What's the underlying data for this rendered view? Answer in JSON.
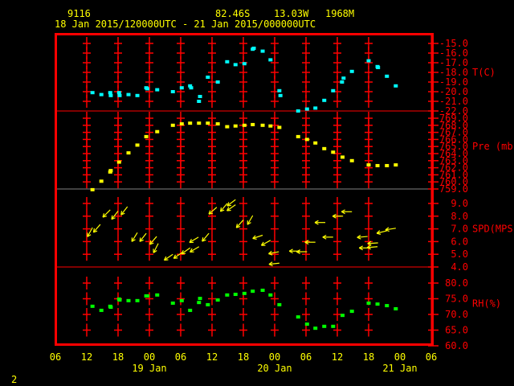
{
  "header": {
    "station_id": "9116",
    "latitude": "82.46S",
    "longitude": "13.03W",
    "elevation": "1968M",
    "time_range": "18 Jan 2015/120000UTC - 21 Jan 2015/000000UTC"
  },
  "page_number": "2",
  "colors": {
    "frame": "#ff0000",
    "text": "#ffff00",
    "temperature": "#00ffff",
    "pressure": "#ffff00",
    "wind": "#ffff00",
    "humidity": "#00ff00"
  },
  "chart_data": {
    "type": "scatter",
    "title": "9116 82.46S 13.03W 1968M",
    "subtitle": "18 Jan 2015/120000UTC - 21 Jan 2015/000000UTC",
    "x_units": "hours since 18 Jan 2015 12 UTC",
    "xlim": [
      -6,
      66
    ],
    "x_tick_labels": [
      "06",
      "12",
      "18",
      "00",
      "06",
      "12",
      "18",
      "00",
      "06",
      "12",
      "18",
      "00",
      "06"
    ],
    "x_date_labels": [
      {
        "label": "19 Jan",
        "t": 12
      },
      {
        "label": "20 Jan",
        "t": 36
      },
      {
        "label": "21 Jan",
        "t": 60
      }
    ],
    "panels": [
      {
        "name": "temperature",
        "label": "T(C)",
        "ylim": [
          -22,
          -15
        ],
        "label_value": -18,
        "tick_labels": [
          "-15.0",
          "-16.0",
          "-17.0",
          "-18.0",
          "-19.0",
          "-20.0",
          "-21.0",
          "-22.0"
        ],
        "tick_values": [
          -15,
          -16,
          -17,
          -18,
          -19,
          -20,
          -21,
          -22
        ],
        "points": [
          [
            1.1,
            -20.1
          ],
          [
            2.8,
            -20.3
          ],
          [
            4.5,
            -20.1
          ],
          [
            4.6,
            -20.4
          ],
          [
            6.2,
            -20.1
          ],
          [
            6.3,
            -20.4
          ],
          [
            8.0,
            -20.3
          ],
          [
            9.7,
            -20.4
          ],
          [
            11.4,
            -19.6
          ],
          [
            11.6,
            -19.7
          ],
          [
            13.5,
            -19.8
          ],
          [
            16.5,
            -20.0
          ],
          [
            18.2,
            -19.6
          ],
          [
            19.8,
            -19.4
          ],
          [
            20.0,
            -19.6
          ],
          [
            21.7,
            -20.5
          ],
          [
            21.5,
            -21.0
          ],
          [
            23.2,
            -18.5
          ],
          [
            25.1,
            -19.0
          ],
          [
            26.9,
            -16.9
          ],
          [
            28.5,
            -17.2
          ],
          [
            30.2,
            -17.1
          ],
          [
            31.8,
            -15.6
          ],
          [
            32.0,
            -15.5
          ],
          [
            33.7,
            -15.8
          ],
          [
            35.2,
            -16.7
          ],
          [
            36.9,
            -19.9
          ],
          [
            37.1,
            -20.4
          ],
          [
            40.5,
            -22.0
          ],
          [
            42.2,
            -21.8
          ],
          [
            43.8,
            -21.7
          ],
          [
            45.5,
            -20.9
          ],
          [
            47.2,
            -19.9
          ],
          [
            48.9,
            -19.0
          ],
          [
            49.2,
            -18.6
          ],
          [
            50.8,
            -17.9
          ],
          [
            54.0,
            -16.8
          ],
          [
            55.7,
            -17.4
          ],
          [
            55.8,
            -17.5
          ],
          [
            57.5,
            -18.4
          ],
          [
            59.2,
            -19.4
          ]
        ]
      },
      {
        "name": "pressure",
        "label": "Pre (mb)",
        "ylim": [
          759,
          769
        ],
        "label_value": 765,
        "tick_labels": [
          "769.0",
          "768.0",
          "767.0",
          "766.0",
          "765.0",
          "764.0",
          "763.0",
          "762.0",
          "761.0",
          "760.0",
          "759.0"
        ],
        "tick_values": [
          769,
          768,
          767,
          766,
          765,
          764,
          763,
          762,
          761,
          760,
          759
        ],
        "points": [
          [
            1.1,
            758.9
          ],
          [
            2.8,
            760.1
          ],
          [
            4.5,
            761.4
          ],
          [
            4.6,
            761.6
          ],
          [
            6.2,
            762.8
          ],
          [
            8.0,
            764.1
          ],
          [
            9.7,
            765.2
          ],
          [
            11.4,
            766.4
          ],
          [
            13.5,
            767.1
          ],
          [
            16.5,
            768.0
          ],
          [
            18.2,
            768.2
          ],
          [
            19.8,
            768.3
          ],
          [
            21.5,
            768.3
          ],
          [
            23.2,
            768.3
          ],
          [
            25.1,
            768.2
          ],
          [
            26.9,
            767.8
          ],
          [
            28.5,
            767.9
          ],
          [
            30.2,
            768.0
          ],
          [
            31.8,
            768.1
          ],
          [
            33.7,
            768.0
          ],
          [
            35.2,
            767.9
          ],
          [
            36.9,
            767.7
          ],
          [
            40.5,
            766.4
          ],
          [
            42.2,
            766.0
          ],
          [
            43.8,
            765.5
          ],
          [
            45.5,
            764.7
          ],
          [
            47.2,
            764.2
          ],
          [
            49.0,
            763.5
          ],
          [
            50.8,
            763.0
          ],
          [
            54.0,
            762.4
          ],
          [
            55.7,
            762.3
          ],
          [
            57.5,
            762.3
          ],
          [
            59.2,
            762.4
          ]
        ]
      },
      {
        "name": "wind_speed",
        "label": "SPD(MPS)",
        "ylim": [
          4,
          9
        ],
        "label_value": 7,
        "tick_labels": [
          "9.0",
          "8.0",
          "7.0",
          "6.0",
          "5.0",
          "4.0"
        ],
        "tick_values": [
          9,
          8,
          7,
          6,
          5,
          4
        ],
        "arrows_note": "t, speed, bearing the arrow points to (deg)",
        "arrows": [
          [
            1.1,
            7.1,
            209
          ],
          [
            2.6,
            7.35,
            221
          ],
          [
            4.5,
            8.5,
            225
          ],
          [
            6.0,
            8.4,
            218
          ],
          [
            7.8,
            8.75,
            218
          ],
          [
            9.7,
            6.7,
            212
          ],
          [
            11.4,
            6.65,
            218
          ],
          [
            13.4,
            6.4,
            221
          ],
          [
            13.7,
            5.85,
            207
          ],
          [
            16.5,
            5.0,
            236
          ],
          [
            18.3,
            5.15,
            235
          ],
          [
            19.8,
            5.5,
            235
          ],
          [
            21.5,
            5.6,
            239
          ],
          [
            21.4,
            6.35,
            239
          ],
          [
            23.4,
            6.65,
            220
          ],
          [
            24.9,
            8.7,
            229
          ],
          [
            26.9,
            9.0,
            220
          ],
          [
            28.5,
            9.3,
            233
          ],
          [
            28.5,
            8.9,
            235
          ],
          [
            30.0,
            7.7,
            222
          ],
          [
            31.8,
            8.05,
            210
          ],
          [
            33.7,
            6.5,
            252
          ],
          [
            35.2,
            6.1,
            241
          ],
          [
            36.8,
            5.2,
            259
          ],
          [
            36.9,
            4.3,
            264
          ],
          [
            40.8,
            5.25,
            270
          ],
          [
            42.2,
            5.2,
            270
          ],
          [
            43.8,
            5.95,
            270
          ],
          [
            45.7,
            7.5,
            270
          ],
          [
            47.2,
            6.35,
            270
          ],
          [
            49.1,
            8.0,
            270
          ],
          [
            50.8,
            8.35,
            270
          ],
          [
            53.8,
            6.4,
            265
          ],
          [
            54.2,
            5.5,
            270
          ],
          [
            55.7,
            5.6,
            265
          ],
          [
            55.8,
            5.9,
            266
          ],
          [
            57.5,
            6.85,
            256
          ],
          [
            59.2,
            7.05,
            261
          ]
        ]
      },
      {
        "name": "relative_humidity",
        "label": "RH(%)",
        "ylim": [
          60,
          80
        ],
        "label_value": 73.5,
        "tick_labels": [
          "80.0",
          "75.0",
          "70.0",
          "65.0",
          "60.0"
        ],
        "tick_values": [
          80,
          75,
          70,
          65,
          60
        ],
        "points": [
          [
            1.1,
            72.6
          ],
          [
            2.8,
            71.3
          ],
          [
            4.5,
            72.6
          ],
          [
            4.6,
            72.3
          ],
          [
            6.2,
            74.9
          ],
          [
            6.3,
            74.6
          ],
          [
            8.0,
            74.4
          ],
          [
            9.7,
            74.4
          ],
          [
            11.4,
            75.9
          ],
          [
            11.6,
            75.9
          ],
          [
            13.5,
            76.2
          ],
          [
            16.5,
            73.6
          ],
          [
            18.2,
            74.4
          ],
          [
            19.8,
            71.3
          ],
          [
            21.5,
            73.8
          ],
          [
            21.7,
            75.1
          ],
          [
            23.2,
            73.1
          ],
          [
            25.1,
            74.6
          ],
          [
            26.9,
            76.2
          ],
          [
            28.5,
            76.4
          ],
          [
            30.2,
            76.7
          ],
          [
            31.8,
            77.4
          ],
          [
            33.7,
            77.7
          ],
          [
            35.2,
            76.2
          ],
          [
            36.9,
            73.1
          ],
          [
            40.5,
            69.2
          ],
          [
            42.2,
            66.9
          ],
          [
            43.8,
            65.6
          ],
          [
            45.5,
            66.2
          ],
          [
            47.2,
            66.2
          ],
          [
            49.0,
            69.7
          ],
          [
            50.8,
            71.0
          ],
          [
            54.0,
            73.6
          ],
          [
            55.7,
            73.3
          ],
          [
            57.5,
            72.8
          ],
          [
            59.2,
            71.8
          ]
        ]
      }
    ]
  }
}
